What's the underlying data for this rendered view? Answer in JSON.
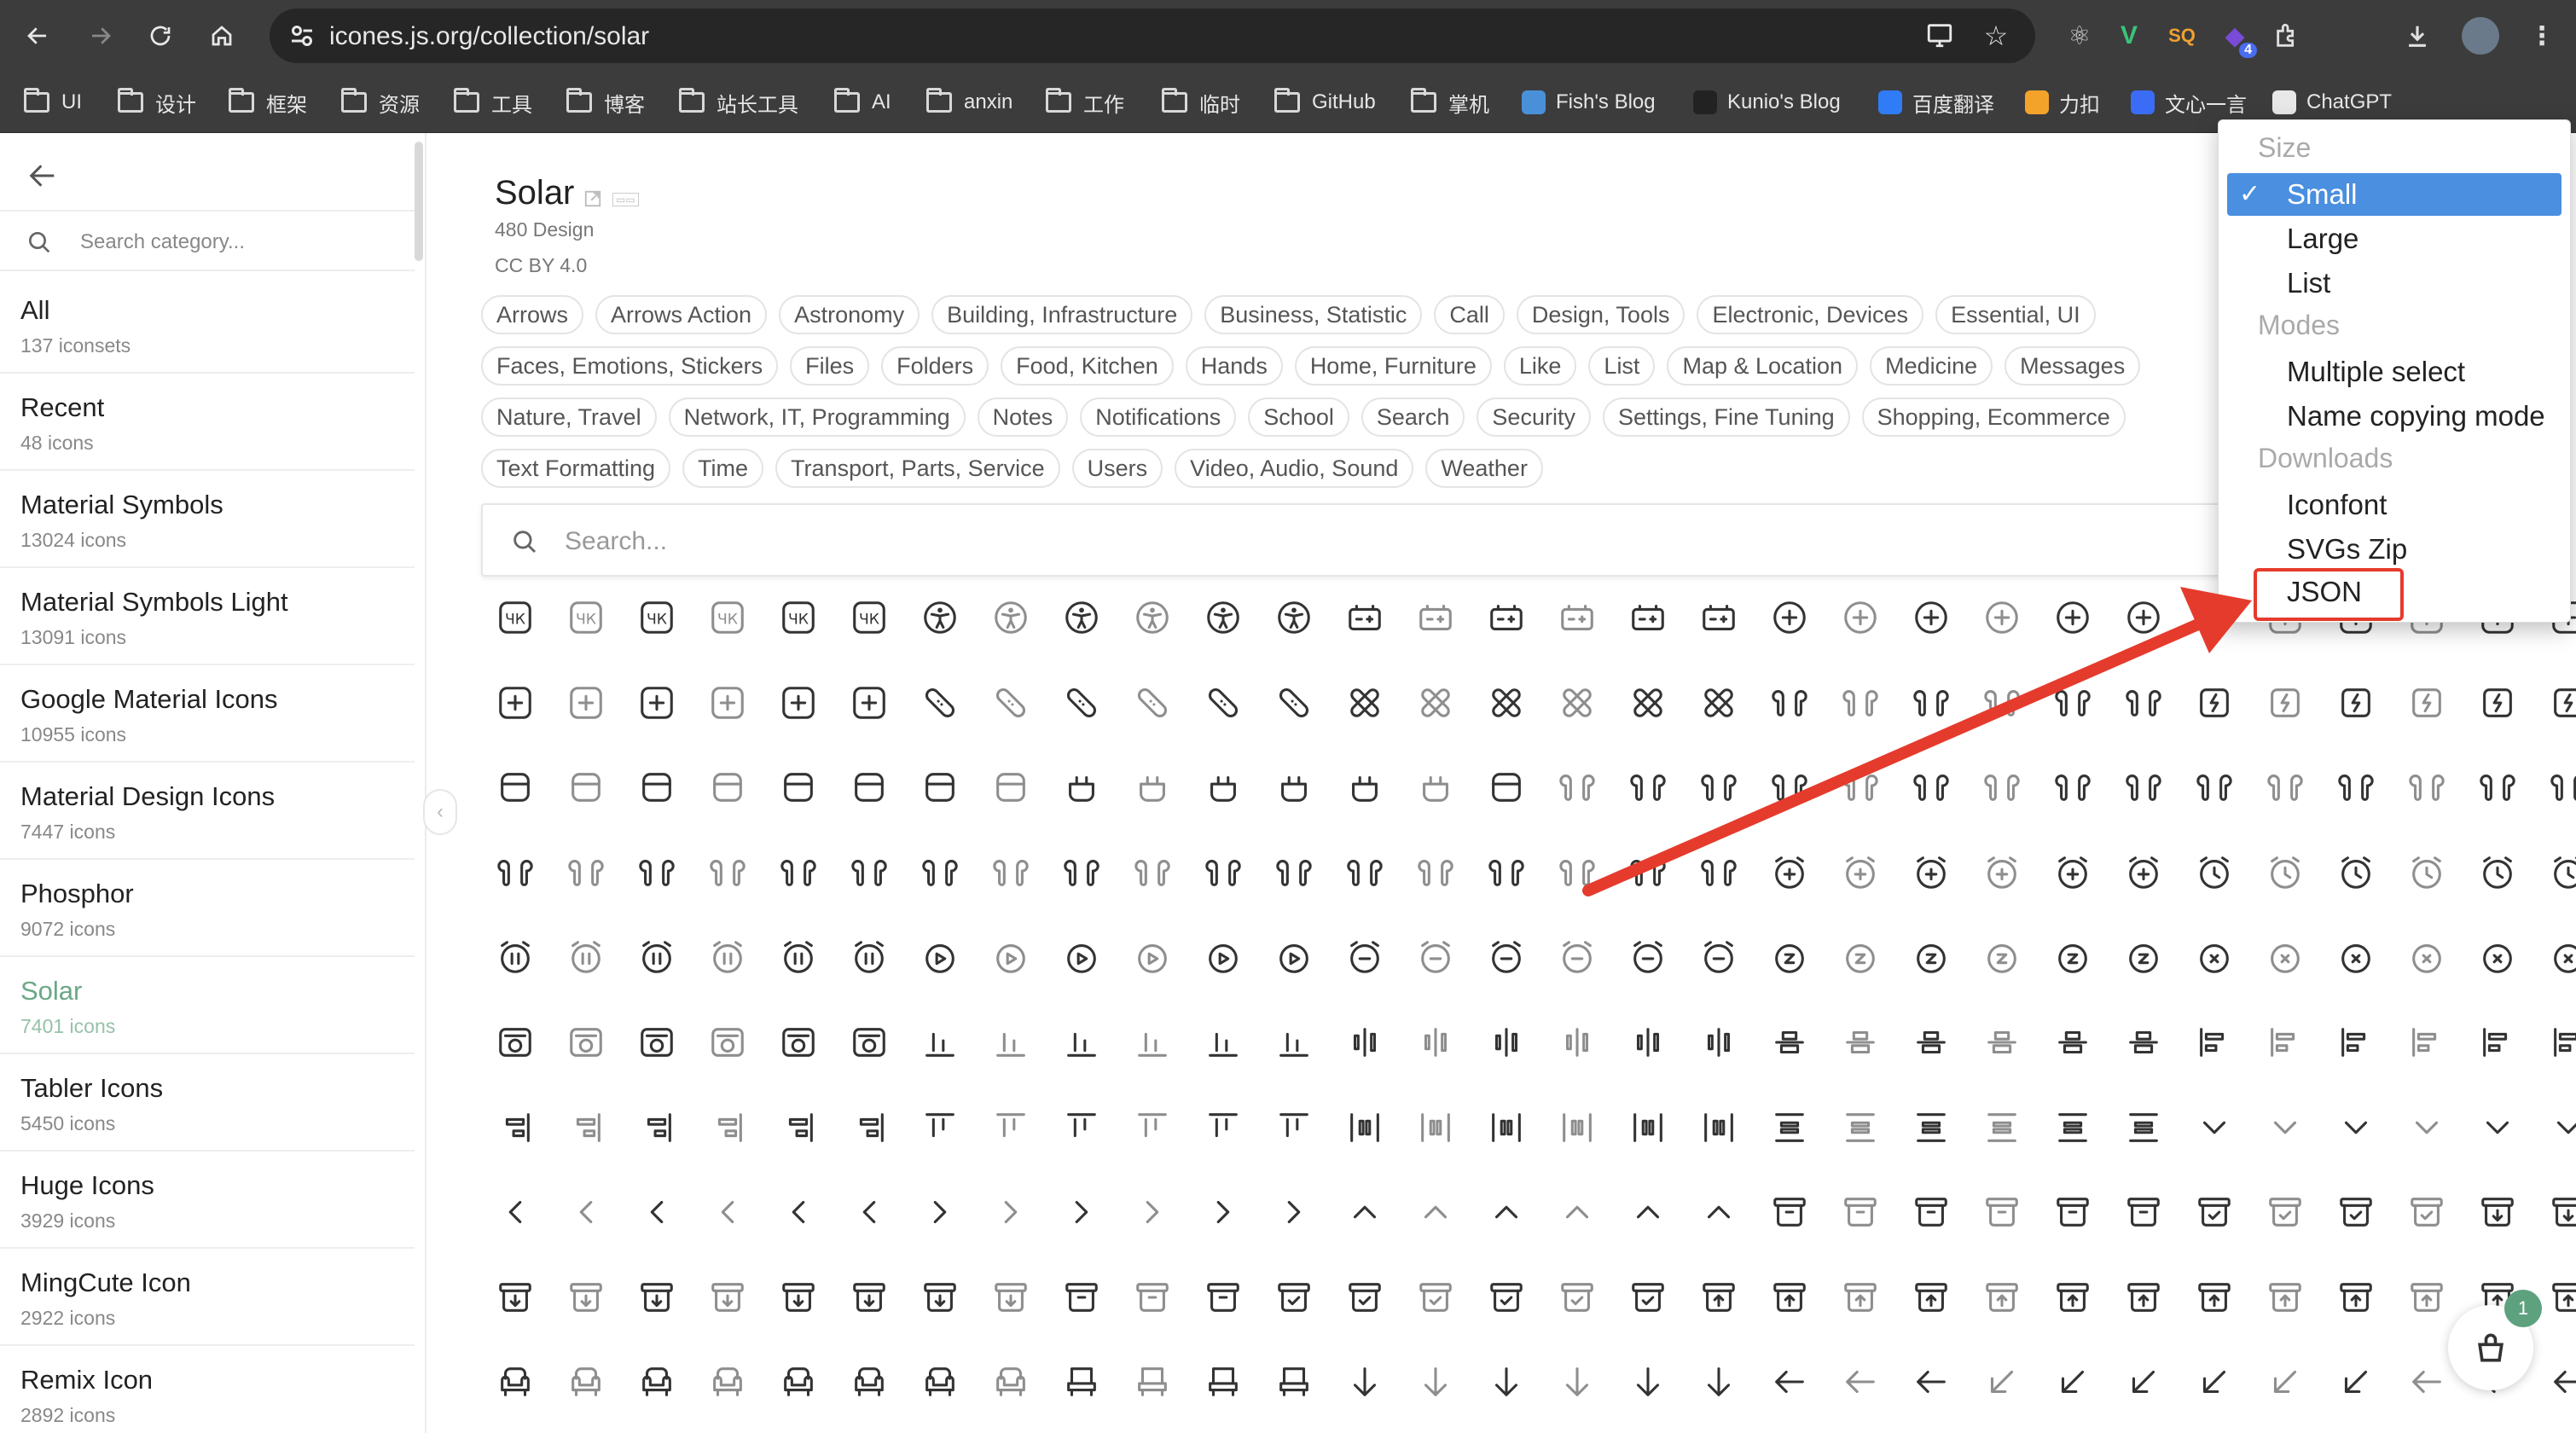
{
  "browser": {
    "url": "icones.js.org/collection/solar",
    "bookmarks": [
      {
        "label": "UI",
        "kind": "folder"
      },
      {
        "label": "设计",
        "kind": "folder"
      },
      {
        "label": "框架",
        "kind": "folder"
      },
      {
        "label": "资源",
        "kind": "folder"
      },
      {
        "label": "工具",
        "kind": "folder"
      },
      {
        "label": "博客",
        "kind": "folder"
      },
      {
        "label": "站长工具",
        "kind": "folder"
      },
      {
        "label": "AI",
        "kind": "folder"
      },
      {
        "label": "anxin",
        "kind": "folder"
      },
      {
        "label": "工作",
        "kind": "folder"
      },
      {
        "label": "临时",
        "kind": "folder"
      },
      {
        "label": "GitHub",
        "kind": "folder"
      },
      {
        "label": "掌机",
        "kind": "folder"
      },
      {
        "label": "Fish's Blog",
        "kind": "site",
        "color": "#4a90d9"
      },
      {
        "label": "Kunio's Blog",
        "kind": "site",
        "color": "#222222"
      },
      {
        "label": "百度翻译",
        "kind": "site",
        "color": "#2f7cf6"
      },
      {
        "label": "力扣",
        "kind": "site",
        "color": "#f4a32a"
      },
      {
        "label": "文心一言",
        "kind": "site",
        "color": "#3b6cf6"
      },
      {
        "label": "ChatGPT",
        "kind": "site",
        "color": "#e8e8e8"
      }
    ],
    "extension_badge": "4"
  },
  "sidebar": {
    "search_placeholder": "Search category...",
    "collections": [
      {
        "name": "All",
        "count": "137 iconsets"
      },
      {
        "name": "Recent",
        "count": "48 icons"
      },
      {
        "name": "Material Symbols",
        "count": "13024 icons"
      },
      {
        "name": "Material Symbols Light",
        "count": "13091 icons"
      },
      {
        "name": "Google Material Icons",
        "count": "10955 icons"
      },
      {
        "name": "Material Design Icons",
        "count": "7447 icons"
      },
      {
        "name": "Phosphor",
        "count": "9072 icons"
      },
      {
        "name": "Solar",
        "count": "7401 icons",
        "active": true
      },
      {
        "name": "Tabler Icons",
        "count": "5450 icons"
      },
      {
        "name": "Huge Icons",
        "count": "3929 icons"
      },
      {
        "name": "MingCute Icon",
        "count": "2922 icons"
      },
      {
        "name": "Remix Icon",
        "count": "2892 icons"
      }
    ]
  },
  "collection": {
    "title": "Solar",
    "author": "480 Design",
    "license": "CC BY 4.0",
    "tag_rows": [
      [
        "Arrows",
        "Arrows Action",
        "Astronomy",
        "Building, Infrastructure",
        "Business, Statistic",
        "Call",
        "Design, Tools",
        "Electronic, Devices",
        "Essential, UI"
      ],
      [
        "Faces, Emotions, Stickers",
        "Files",
        "Folders",
        "Food, Kitchen",
        "Hands",
        "Home, Furniture",
        "Like",
        "List",
        "Map & Location",
        "Medicine",
        "Messages"
      ],
      [
        "Nature, Travel",
        "Network, IT, Programming",
        "Notes",
        "Notifications",
        "School",
        "Search",
        "Security",
        "Settings, Fine Tuning",
        "Shopping, Ecommerce"
      ],
      [
        "Text Formatting",
        "Time",
        "Transport, Parts, Service",
        "Users",
        "Video, Audio, Sound",
        "Weather"
      ]
    ],
    "search_placeholder": "Search..."
  },
  "icon_rows": [
    [
      "ck",
      "ck",
      "ck",
      "ck",
      "ck",
      "ck",
      "person",
      "person",
      "person",
      "person",
      "person",
      "person",
      "battery",
      "battery",
      "battery",
      "battery",
      "battery",
      "battery",
      "add-circle",
      "add-circle",
      "add-circle",
      "add-circle",
      "add-circle",
      "add-circle",
      "folder",
      "add-square",
      "add-square",
      "add-square",
      "add-square",
      "add-square"
    ],
    [
      "add-square",
      "add-square",
      "add-square",
      "add-square",
      "add-square",
      "add-square",
      "bandage",
      "bandage",
      "bandage",
      "bandage",
      "bandage",
      "bandage",
      "bandage-x",
      "bandage-x",
      "bandage-x",
      "bandage-x",
      "bandage-x",
      "bandage-x",
      "airpods",
      "airpods",
      "airpods",
      "airpods",
      "airpods",
      "airpods",
      "bolt",
      "bolt",
      "bolt",
      "bolt",
      "bolt",
      "bolt"
    ],
    [
      "case",
      "case",
      "case",
      "case",
      "case",
      "case",
      "case",
      "case",
      "airpod-case",
      "airpod-case",
      "airpod-case",
      "airpod-case",
      "airpod-case",
      "airpod-case",
      "case",
      "airpods",
      "airpods",
      "airpods",
      "airpods",
      "airpods",
      "airpods",
      "airpods",
      "airpods",
      "airpods",
      "airpods",
      "airpods",
      "airpods",
      "airpods",
      "airpods",
      "airpods"
    ],
    [
      "airpods",
      "airpods",
      "airpods",
      "airpods",
      "airpods",
      "airpods",
      "airpods",
      "airpods",
      "airpods",
      "airpods",
      "airpods",
      "airpods",
      "airpods",
      "airpods",
      "airpods",
      "airpods",
      "airpods",
      "airpods",
      "alarm-add",
      "alarm-add",
      "alarm-add",
      "alarm-add",
      "alarm-add",
      "alarm-add",
      "alarm",
      "alarm",
      "alarm",
      "alarm",
      "alarm",
      "alarm"
    ],
    [
      "alarm-pause",
      "alarm-pause",
      "alarm-pause",
      "alarm-pause",
      "alarm-pause",
      "alarm-pause",
      "alarm-play",
      "alarm-play",
      "alarm-play",
      "alarm-play",
      "alarm-play",
      "alarm-play",
      "alarm-minus",
      "alarm-minus",
      "alarm-minus",
      "alarm-minus",
      "alarm-minus",
      "alarm-minus",
      "alarm-sleep",
      "alarm-sleep",
      "alarm-sleep",
      "alarm-sleep",
      "alarm-sleep",
      "alarm-sleep",
      "alarm-x",
      "alarm-x",
      "alarm-x",
      "alarm-x",
      "alarm-x",
      "alarm-x"
    ],
    [
      "album",
      "album",
      "album",
      "album",
      "album",
      "album",
      "align-bottom",
      "align-bottom",
      "align-bottom",
      "align-bottom",
      "align-bottom",
      "align-bottom",
      "align-h-center",
      "align-h-center",
      "align-h-center",
      "align-h-center",
      "align-h-center",
      "align-h-center",
      "align-v-center",
      "align-v-center",
      "align-v-center",
      "align-v-center",
      "align-v-center",
      "align-v-center",
      "align-left",
      "align-left",
      "align-left",
      "align-left",
      "align-left",
      "align-left"
    ],
    [
      "align-right",
      "align-right",
      "align-right",
      "align-right",
      "align-right",
      "align-right",
      "align-top",
      "align-top",
      "align-top",
      "align-top",
      "align-top",
      "align-top",
      "align-v-spread",
      "align-v-spread",
      "align-v-spread",
      "align-v-spread",
      "align-v-spread",
      "align-v-spread",
      "align-h-spread",
      "align-h-spread",
      "align-h-spread",
      "align-h-spread",
      "align-h-spread",
      "align-h-spread",
      "alt-arrow-down",
      "alt-arrow-down",
      "alt-arrow-down",
      "alt-arrow-down",
      "alt-arrow-down",
      "alt-arrow-down"
    ],
    [
      "alt-arrow-left",
      "alt-arrow-left",
      "alt-arrow-left",
      "alt-arrow-left",
      "alt-arrow-left",
      "alt-arrow-left",
      "alt-arrow-right",
      "alt-arrow-right",
      "alt-arrow-right",
      "alt-arrow-right",
      "alt-arrow-right",
      "alt-arrow-right",
      "alt-arrow-up",
      "alt-arrow-up",
      "alt-arrow-up",
      "alt-arrow-up",
      "alt-arrow-up",
      "alt-arrow-up",
      "archive",
      "archive",
      "archive",
      "archive",
      "archive",
      "archive",
      "archive-check",
      "archive-check",
      "archive-check",
      "archive-check",
      "archive-down",
      "archive-down"
    ],
    [
      "archive-down",
      "archive-down",
      "archive-down",
      "archive-down",
      "archive-down",
      "archive-down",
      "archive-down",
      "archive-down",
      "archive",
      "archive",
      "archive",
      "archive-check",
      "archive-check",
      "archive-check",
      "archive-check",
      "archive-check",
      "archive-check",
      "archive-up",
      "archive-up",
      "archive-up",
      "archive-up",
      "archive-up",
      "archive-up",
      "archive-up",
      "archive-up",
      "archive-up",
      "archive-up",
      "archive-up",
      "archive-up",
      "archive-up"
    ],
    [
      "armchair",
      "armchair",
      "armchair",
      "armchair",
      "armchair",
      "armchair",
      "armchair",
      "armchair",
      "armchair-2",
      "armchair-2",
      "armchair-2",
      "armchair-2",
      "arrow-down",
      "arrow-down",
      "arrow-down",
      "arrow-down",
      "arrow-down",
      "arrow-down",
      "arrow-left",
      "arrow-left",
      "arrow-left",
      "arrow-down-left",
      "arrow-down-left",
      "arrow-down-left",
      "arrow-down-left",
      "arrow-down-left",
      "arrow-down-left",
      "arrow-left",
      "arrow-left",
      "arrow-left"
    ]
  ],
  "menu": {
    "size_header": "Size",
    "size_items": [
      {
        "label": "Small",
        "selected": true
      },
      {
        "label": "Large"
      },
      {
        "label": "List"
      }
    ],
    "modes_header": "Modes",
    "mode_items": [
      {
        "label": "Multiple select"
      },
      {
        "label": "Name copying mode"
      }
    ],
    "downloads_header": "Downloads",
    "download_items": [
      {
        "label": "Iconfont"
      },
      {
        "label": "SVGs Zip"
      },
      {
        "label": "JSON"
      }
    ]
  },
  "bag": {
    "count": "1"
  },
  "colors": {
    "accent": "#6aa886",
    "menu_select": "#4a8fe0",
    "annotation": "#e53b2c"
  }
}
